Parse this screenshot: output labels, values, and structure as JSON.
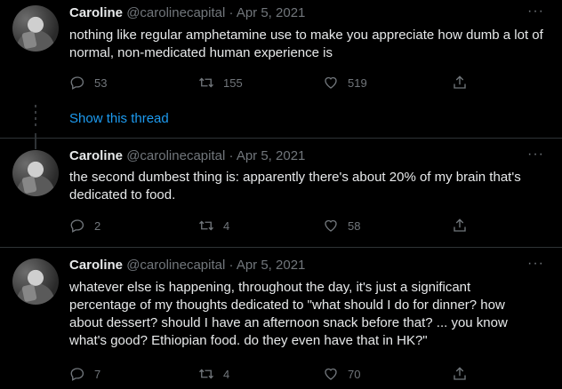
{
  "thread": {
    "show_thread_label": "Show this thread"
  },
  "tweets": [
    {
      "name": "Caroline",
      "handle": "@carolinecapital",
      "separator": "·",
      "date": "Apr 5, 2021",
      "more": "···",
      "text": "nothing like regular amphetamine use to make you appreciate how dumb a lot of normal, non-medicated human experience is",
      "replies": "53",
      "retweets": "155",
      "likes": "519"
    },
    {
      "name": "Caroline",
      "handle": "@carolinecapital",
      "separator": "·",
      "date": "Apr 5, 2021",
      "more": "···",
      "text": "the second dumbest thing is: apparently there's about 20% of my brain that's dedicated to food.",
      "replies": "2",
      "retweets": "4",
      "likes": "58"
    },
    {
      "name": "Caroline",
      "handle": "@carolinecapital",
      "separator": "·",
      "date": "Apr 5, 2021",
      "more": "···",
      "text": "whatever else is happening, throughout the day, it's just a significant percentage of my thoughts dedicated to \"what should I do for dinner? how about dessert? should I have an afternoon snack before that? ... you know what's good? Ethiopian food. do they even have that in HK?\"",
      "replies": "7",
      "retweets": "4",
      "likes": "70"
    }
  ],
  "icons": {
    "reply": "reply-icon",
    "retweet": "retweet-icon",
    "like": "heart-icon",
    "share": "share-icon",
    "more": "more-icon"
  },
  "colors": {
    "background": "#000000",
    "text": "#e7e9ea",
    "muted": "#71767b",
    "link": "#1d9bf0",
    "line": "#2f3336"
  }
}
